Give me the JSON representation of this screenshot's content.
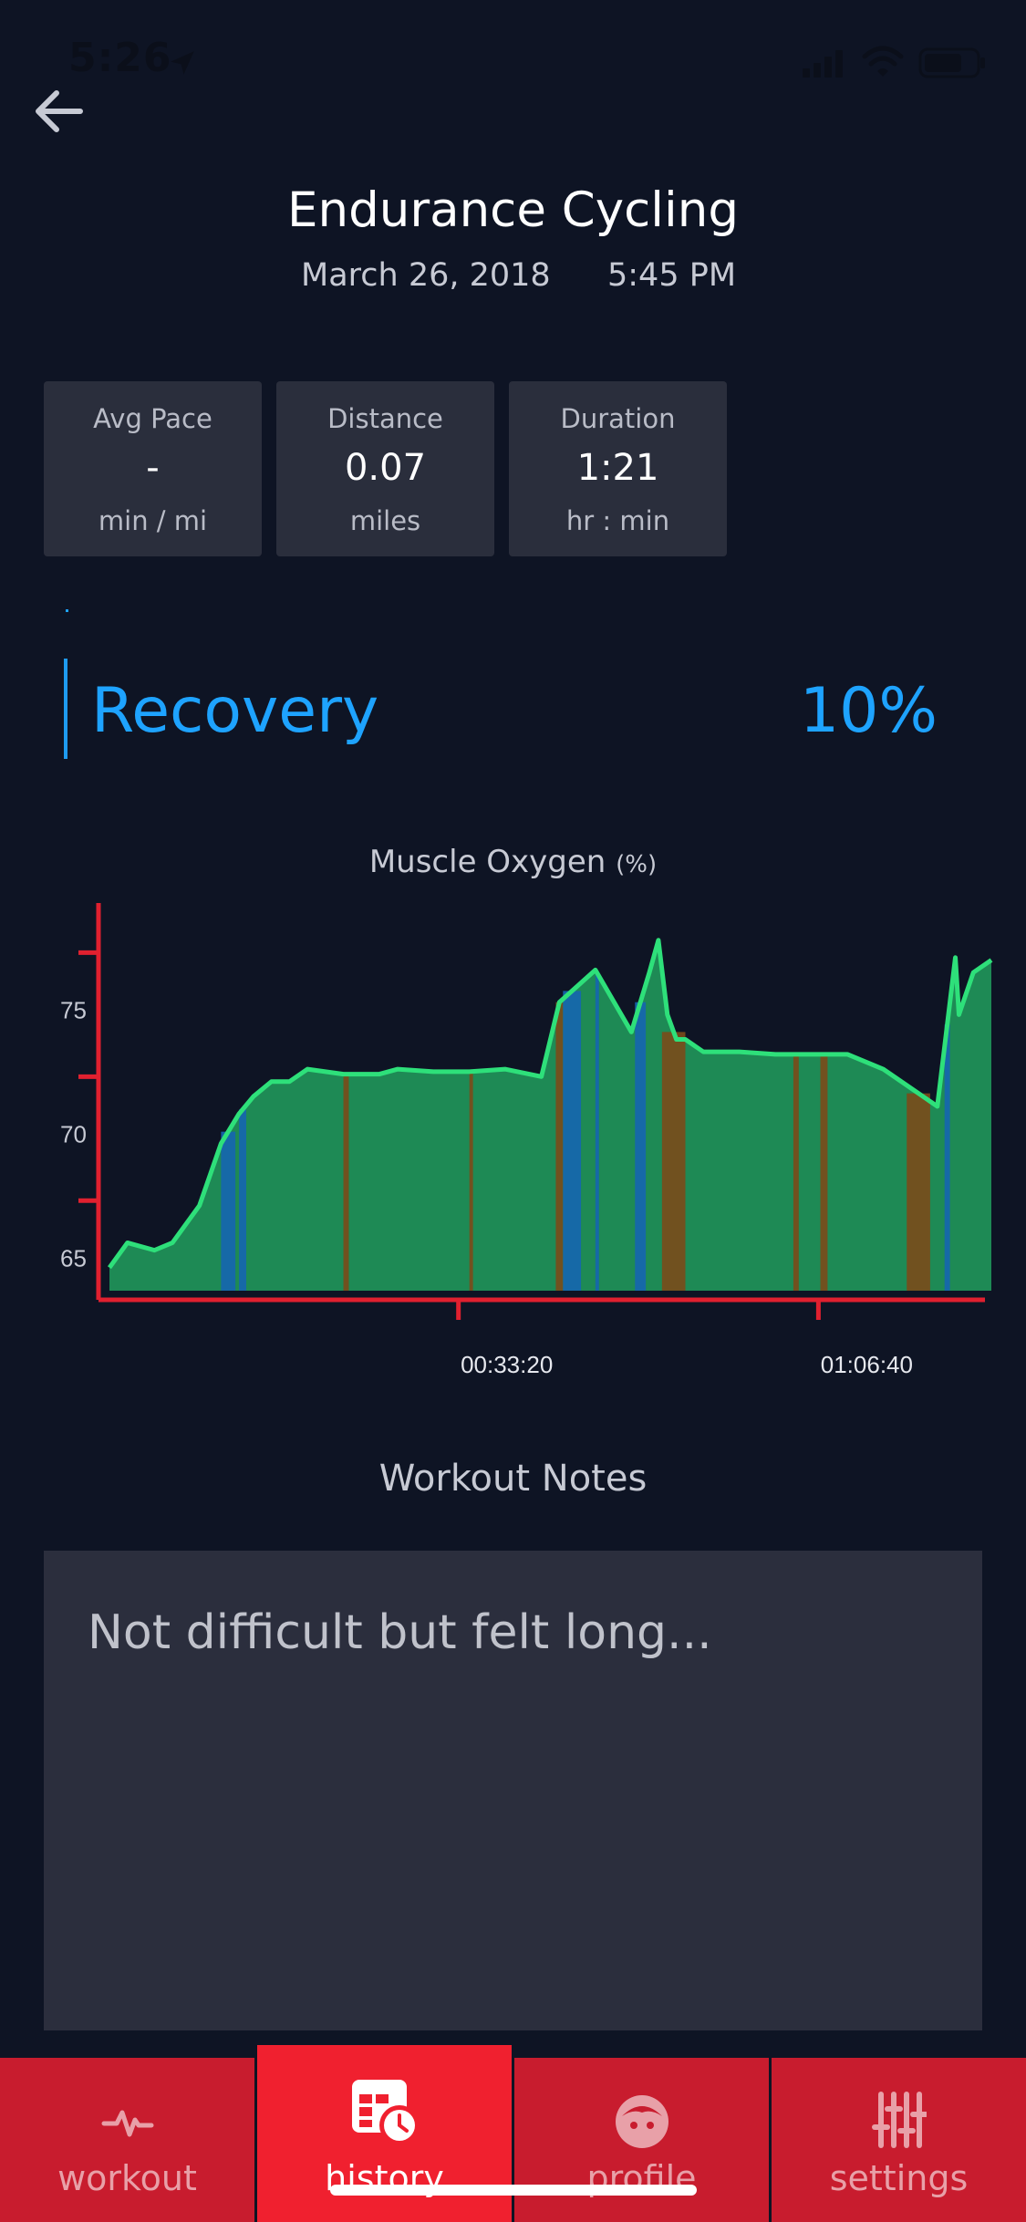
{
  "status_bar": {
    "time": "5:26"
  },
  "header": {
    "title": "Endurance Cycling",
    "date": "March 26, 2018",
    "time": "5:45 PM"
  },
  "stats": [
    {
      "label": "Avg Pace",
      "value": "-",
      "unit": "min / mi"
    },
    {
      "label": "Distance",
      "value": "0.07",
      "unit": "miles"
    },
    {
      "label": "Duration",
      "value": "1:21",
      "unit": "hr : min"
    }
  ],
  "zone": {
    "label": "Recovery",
    "value": "10%"
  },
  "chart": {
    "title": "Muscle Oxygen",
    "unit": "(%)"
  },
  "chart_data": {
    "type": "area",
    "title": "Muscle Oxygen (%)",
    "xlabel": "",
    "ylabel": "",
    "y_ticks": [
      "65",
      "70",
      "75"
    ],
    "x_ticks": [
      "00:33:20",
      "01:06:40"
    ],
    "ylim": [
      63,
      79
    ],
    "xlim": [
      0,
      4900
    ],
    "grid": false,
    "colors": {
      "axis": "#e0202f",
      "line": "#2ee07a",
      "fill": "#1e8a55",
      "zone_low": "#1565b0",
      "zone_high": "#7a4a1a"
    },
    "x": [
      0,
      100,
      250,
      350,
      500,
      620,
      720,
      800,
      900,
      1000,
      1100,
      1300,
      1500,
      1600,
      1800,
      2000,
      2200,
      2400,
      2500,
      2700,
      2900,
      3000,
      3050,
      3100,
      3150,
      3200,
      3300,
      3400,
      3500,
      3700,
      3900,
      4100,
      4300,
      4500,
      4600,
      4700,
      4720,
      4800,
      4900
    ],
    "y": [
      64.3,
      65.3,
      65.0,
      65.3,
      66.8,
      69.3,
      70.5,
      71.2,
      71.8,
      71.8,
      72.3,
      72.1,
      72.1,
      72.3,
      72.2,
      72.2,
      72.3,
      72.0,
      75.0,
      76.3,
      73.8,
      76.2,
      77.5,
      74.5,
      73.5,
      73.5,
      73.0,
      73.0,
      73.0,
      72.9,
      72.9,
      72.9,
      72.3,
      71.3,
      70.8,
      76.8,
      74.5,
      76.2,
      76.7
    ]
  },
  "notes": {
    "title": "Workout Notes",
    "text": "Not difficult but felt long..."
  },
  "tabs": [
    {
      "label": "workout",
      "icon": "pulse-icon"
    },
    {
      "label": "history",
      "icon": "calendar-clock-icon"
    },
    {
      "label": "profile",
      "icon": "face-icon"
    },
    {
      "label": "settings",
      "icon": "sliders-icon"
    }
  ]
}
